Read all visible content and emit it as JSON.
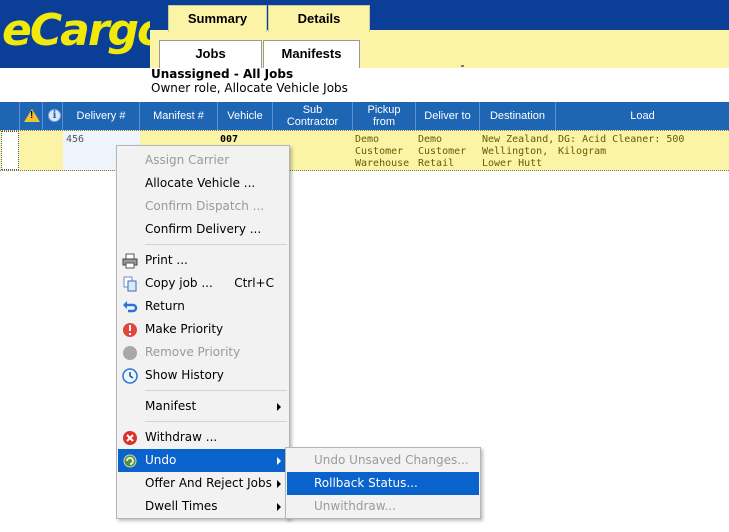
{
  "app": {
    "logo_text": "eCargo"
  },
  "tabs": {
    "top": [
      "Summary",
      "Details"
    ],
    "sub": [
      "Jobs",
      "Manifests"
    ]
  },
  "page": {
    "title": "Unassigned - All Jobs",
    "subtitle": "Owner role, Allocate Vehicle Jobs"
  },
  "grid": {
    "headers": {
      "delivery": "Delivery #",
      "manifest": "Manifest #",
      "vehicle": "Vehicle",
      "subcontractor_1": "Sub",
      "subcontractor_2": "Contractor",
      "pickup_1": "Pickup",
      "pickup_2": "from",
      "deliverto": "Deliver to",
      "destination": "Destination",
      "load": "Load"
    },
    "row": {
      "delivery": "456",
      "vehicle": "007",
      "pickup_1": "Demo",
      "pickup_2": "Customer",
      "pickup_3": "Warehouse",
      "deliverto_1": "Demo",
      "deliverto_2": "Customer",
      "deliverto_3": "Retail",
      "destination_1": "New Zealand,",
      "destination_2": "Wellington,",
      "destination_3": "Lower Hutt",
      "load": "DG: Acid Cleaner: 500 Kilogram"
    }
  },
  "context_menu": {
    "assign_carrier": "Assign Carrier",
    "allocate_vehicle": "Allocate Vehicle ...",
    "confirm_dispatch": "Confirm Dispatch ...",
    "confirm_delivery": "Confirm Delivery ...",
    "print": "Print ...",
    "copy_job": "Copy job ...",
    "copy_shortcut": "Ctrl+C",
    "return": "Return",
    "make_priority": "Make Priority",
    "remove_priority": "Remove Priority",
    "show_history": "Show History",
    "manifest": "Manifest",
    "withdraw": "Withdraw ...",
    "undo": "Undo",
    "offer_reject": "Offer And Reject Jobs",
    "dwell_times": "Dwell Times"
  },
  "undo_submenu": {
    "undo_unsaved": "Undo Unsaved Changes...",
    "rollback_status": "Rollback Status...",
    "unwithdraw": "Unwithdraw..."
  },
  "colors": {
    "header_blue": "#0b3f97",
    "logo_yellow": "#f1e90a",
    "tab_yellow": "#fbf4a6",
    "grid_header": "#1e65b4",
    "menu_highlight": "#0a62cc"
  }
}
